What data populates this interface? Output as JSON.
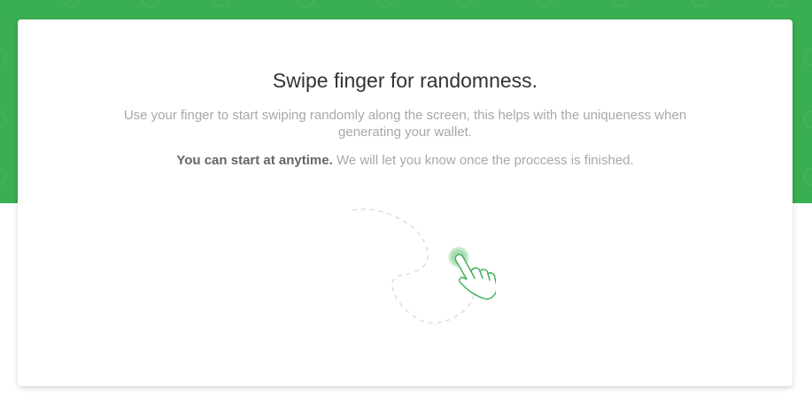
{
  "header": {
    "background_color": "#3aae52"
  },
  "card": {
    "title": "Swipe finger for randomness.",
    "description": "Use your finger to start swiping randomly along the screen, this helps with the uniqueness when generating your wallet.",
    "note_bold": "You can start at anytime.",
    "note_rest": " We will let you know once the proccess is finished."
  },
  "illustration": {
    "icon": "swipe-hand-icon",
    "accent_color": "#3aae52"
  }
}
